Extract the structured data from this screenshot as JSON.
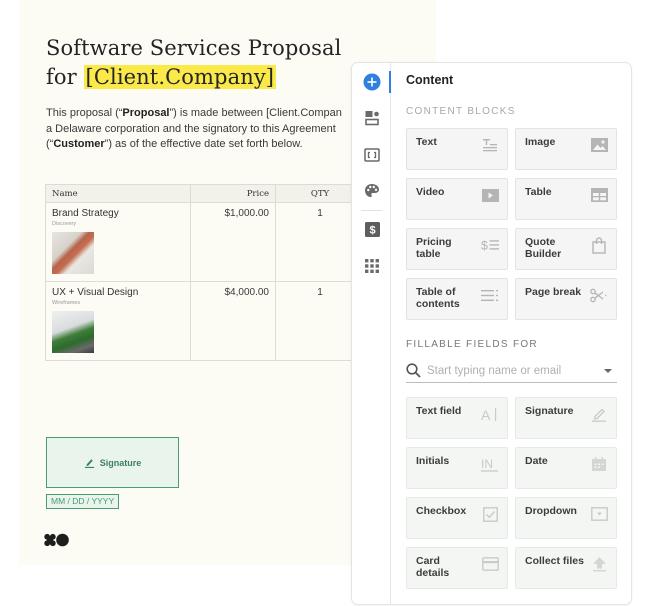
{
  "document": {
    "title_line1": "Software Services Proposal",
    "title_prefix": "for",
    "title_variable": "[Client.Company]",
    "intro": {
      "part1": "This proposal (“",
      "bold1": "Proposal",
      "part2": "”) is made between [Client.Compan",
      "line2": "a Delaware corporation and the signatory to this Agreement",
      "part3": "(“",
      "bold2": "Customer",
      "part4": "”) as of the effective date set forth below."
    },
    "pricing_table": {
      "columns": [
        "Name",
        "Price",
        "QTY"
      ],
      "rows": [
        {
          "name": "Brand Strategy",
          "subtitle": "Discovery",
          "price": "$1,000.00",
          "qty": "1"
        },
        {
          "name": "UX + Visual Design",
          "subtitle": "Wireframes",
          "price": "$4,000.00",
          "qty": "1"
        }
      ]
    },
    "signature_label": "Signature",
    "date_placeholder": "MM / DD / YYYY"
  },
  "panel": {
    "title": "Content",
    "rail_icons": [
      "add-content-icon",
      "blocks-icon",
      "variables-icon",
      "design-palette-icon",
      "pricing-icon",
      "apps-grid-icon"
    ],
    "content_blocks_label": "CONTENT BLOCKS",
    "content_blocks": [
      {
        "label": "Text",
        "icon": "text-icon"
      },
      {
        "label": "Image",
        "icon": "image-icon"
      },
      {
        "label": "Video",
        "icon": "video-icon"
      },
      {
        "label": "Table",
        "icon": "table-icon"
      },
      {
        "label": "Pricing table",
        "icon": "pricing-table-icon"
      },
      {
        "label": "Quote Builder",
        "icon": "quote-builder-icon"
      },
      {
        "label": "Table of contents",
        "icon": "toc-icon"
      },
      {
        "label": "Page break",
        "icon": "scissors-icon"
      }
    ],
    "fillable_fields_label": "FILLABLE FIELDS FOR",
    "recipient_placeholder": "Start typing name or email",
    "fillable_fields": [
      {
        "label": "Text field",
        "icon": "text-field-icon"
      },
      {
        "label": "Signature",
        "icon": "signature-icon"
      },
      {
        "label": "Initials",
        "icon": "initials-icon"
      },
      {
        "label": "Date",
        "icon": "calendar-icon"
      },
      {
        "label": "Checkbox",
        "icon": "checkbox-icon"
      },
      {
        "label": "Dropdown",
        "icon": "dropdown-icon"
      },
      {
        "label": "Card details",
        "icon": "credit-card-icon"
      },
      {
        "label": "Collect files",
        "icon": "upload-icon"
      }
    ],
    "colors": {
      "accent": "#2f80e0",
      "field_green": "#4a9a73",
      "highlight": "#fbe94a"
    }
  }
}
